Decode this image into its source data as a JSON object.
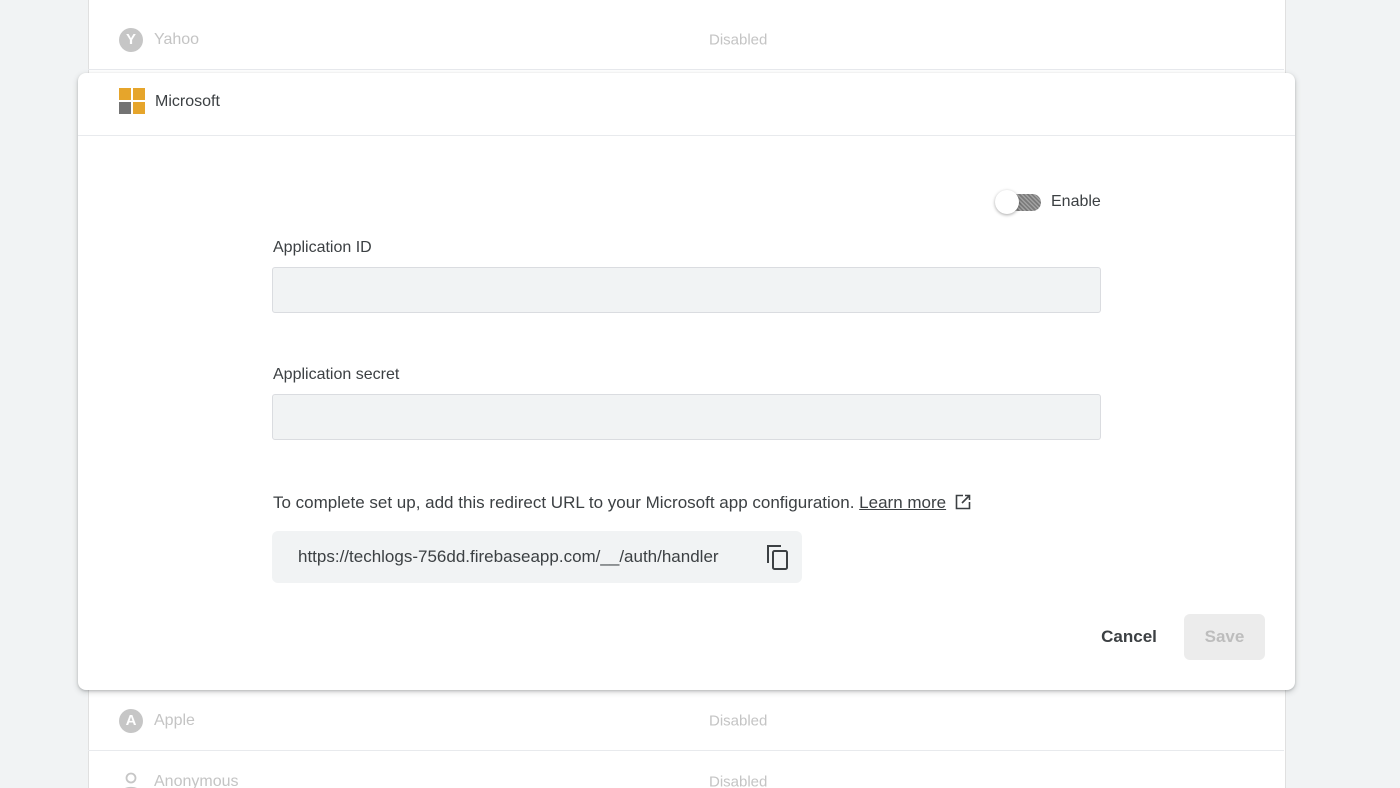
{
  "background_rows": {
    "yahoo": {
      "icon": "yahoo-icon",
      "icon_glyph": "Y",
      "name": "Yahoo",
      "status": "Disabled"
    },
    "apple": {
      "icon": "apple-icon",
      "icon_glyph": "A",
      "name": "Apple",
      "status": "Disabled"
    },
    "anonymous": {
      "icon": "person-icon",
      "name": "Anonymous",
      "status": "Disabled"
    }
  },
  "dialog": {
    "provider_icon": "microsoft-logo-icon",
    "title": "Microsoft",
    "enable_toggle": {
      "label": "Enable",
      "enabled": false
    },
    "application_id": {
      "label": "Application ID",
      "value": ""
    },
    "application_secret": {
      "label": "Application secret",
      "value": ""
    },
    "redirect_note": "To complete set up, add this redirect URL to your Microsoft app configuration.",
    "learn_more_label": "Learn more",
    "learn_more_icon": "external-link-icon",
    "redirect_url": "https://techlogs-756dd.firebaseapp.com/__/auth/handler",
    "copy_icon": "copy-icon",
    "cancel_label": "Cancel",
    "save_label": "Save"
  },
  "colors": {
    "page_bg": "#f1f3f4",
    "text": "#3c4043",
    "muted_text": "#c4c4c4",
    "ms_logo_tiles": [
      "#e6a52b",
      "#e6a52b",
      "#737373",
      "#e6a52b"
    ]
  }
}
